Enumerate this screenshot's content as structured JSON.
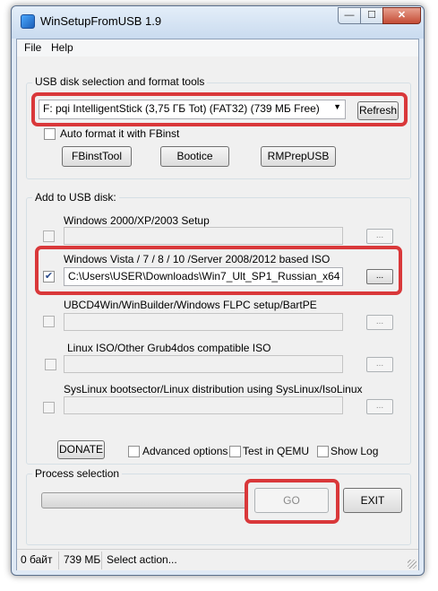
{
  "window": {
    "title": "WinSetupFromUSB 1.9",
    "caption": {
      "minimize": "—",
      "maximize": "☐",
      "close": "✕"
    }
  },
  "menu": [
    "File",
    "Help"
  ],
  "usb_group": {
    "legend": "USB disk selection and format tools",
    "disk_selected": "F: pqi IntelligentStick (3,75 ГБ Tot) (FAT32) (739 МБ Free)",
    "refresh_label": "Refresh",
    "auto_format_label": "Auto format it with FBinst",
    "auto_format_checked": false,
    "tools": [
      "FBinstTool",
      "Bootice",
      "RMPrepUSB"
    ]
  },
  "add_group": {
    "legend": "Add to USB disk:",
    "browse_label": "...",
    "entries": [
      {
        "label": "Windows 2000/XP/2003 Setup",
        "path": "",
        "checked": false
      },
      {
        "label": "Windows Vista / 7 / 8 / 10 /Server 2008/2012 based ISO",
        "path": "C:\\Users\\USER\\Downloads\\Win7_Ult_SP1_Russian_x64",
        "checked": true
      },
      {
        "label": "UBCD4Win/WinBuilder/Windows FLPC setup/BartPE",
        "path": "",
        "checked": false
      },
      {
        "label": "Linux ISO/Other Grub4dos compatible ISO",
        "path": "",
        "checked": false
      },
      {
        "label": "SysLinux bootsector/Linux distribution using SysLinux/IsoLinux",
        "path": "",
        "checked": false
      }
    ]
  },
  "options": {
    "donate_label": "DONATE",
    "advanced_label": "Advanced options",
    "qemu_label": "Test in QEMU",
    "showlog_label": "Show Log"
  },
  "process": {
    "legend": "Process selection",
    "progress": 0,
    "go_label": "GO",
    "exit_label": "EXIT"
  },
  "status": {
    "used": "0 байт",
    "free": "739 МБ",
    "message": "Select action..."
  },
  "colors": {
    "highlight": "#d9383a",
    "window_frame": "#dfe9f5",
    "dialog_bg": "#f0f0f0",
    "check_mark": "#2a4a8a"
  }
}
